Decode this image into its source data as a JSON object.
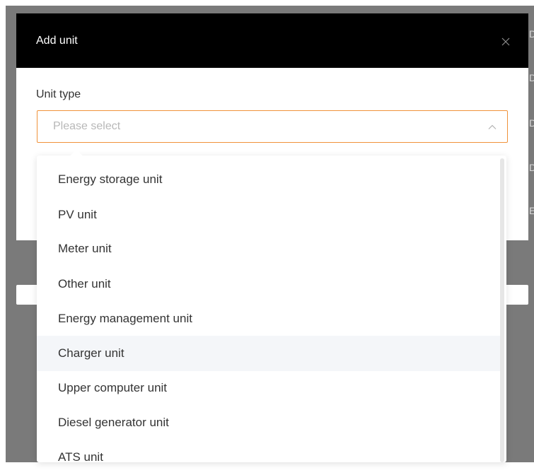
{
  "modal": {
    "title": "Add unit",
    "close_icon": "close-icon"
  },
  "form": {
    "unit_type_label": "Unit type",
    "unit_type_placeholder": "Please select",
    "chevron_icon": "chevron-up-icon",
    "accent_color": "#f0923a"
  },
  "dropdown": {
    "options": [
      "Energy storage unit",
      "PV unit",
      "Meter unit",
      "Other unit",
      "Energy management unit",
      "Charger unit",
      "Upper computer unit",
      "Diesel generator unit",
      "ATS unit"
    ],
    "hovered_option": "Charger unit"
  }
}
